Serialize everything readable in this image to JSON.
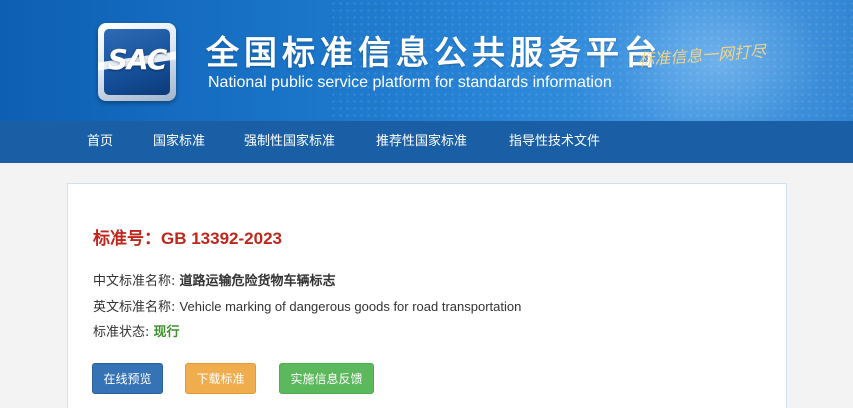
{
  "header": {
    "logo_text": "SAC",
    "title": "全国标准信息公共服务平台",
    "subtitle": "National public service platform  for standards information",
    "slogan": "标准信息一网打尽"
  },
  "nav": {
    "items": [
      {
        "label": "首页"
      },
      {
        "label": "国家标准"
      },
      {
        "label": "强制性国家标准"
      },
      {
        "label": "推荐性国家标准"
      },
      {
        "label": "指导性技术文件"
      }
    ]
  },
  "standard": {
    "number_label": "标准号：",
    "number": "GB 13392-2023",
    "cn_name_label": "中文标准名称:",
    "cn_name": "道路运输危险货物车辆标志",
    "en_name_label": "英文标准名称:",
    "en_name": "Vehicle marking of dangerous goods for road transportation",
    "status_label": "标准状态:",
    "status": "现行"
  },
  "actions": {
    "preview": "在线预览",
    "download": "下载标准",
    "feedback": "实施信息反馈"
  },
  "colors": {
    "banner": "#1a74c8",
    "nav": "#1a5fa6",
    "std_number": "#c0271c",
    "status": "#3f8f2e",
    "btn_preview": "#3572b6",
    "btn_download": "#f0ad4e",
    "btn_feedback": "#5cb85c"
  }
}
